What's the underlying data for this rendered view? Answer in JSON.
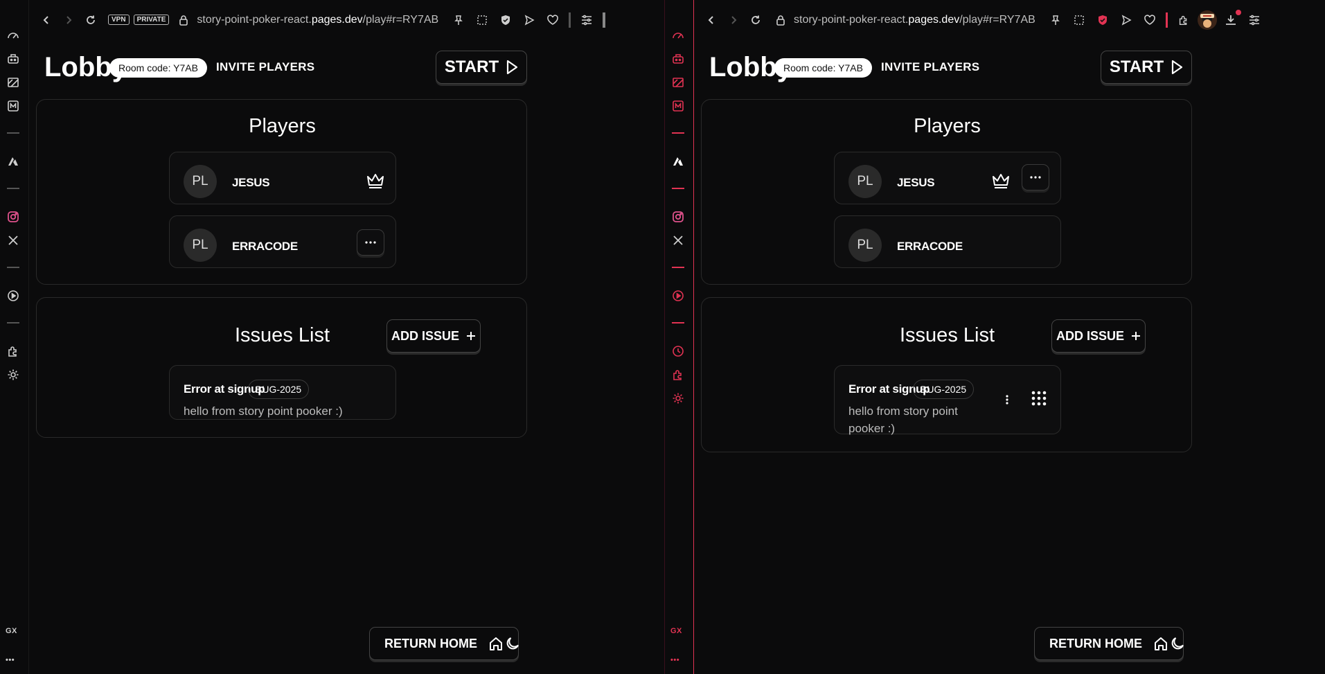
{
  "browser": {
    "tag_vpn": "VPN",
    "tag_private": "PRIVATE",
    "url_prefix": "story-point-poker-react.",
    "url_domain": "pages.dev",
    "url_suffix": "/play#r=RY7AB",
    "sidebar_gx": "GX",
    "sidebar_more": "•••"
  },
  "lobby": {
    "title": "Lobby",
    "room_code": "Room code: Y7AB",
    "invite_label": "INVITE PLAYERS",
    "start_label": "START"
  },
  "players": {
    "heading": "Players",
    "list": [
      {
        "initials": "PL",
        "name": "JESUS",
        "is_host": true
      },
      {
        "initials": "PL",
        "name": "ERRACODE",
        "is_host": false
      }
    ]
  },
  "issues": {
    "heading": "Issues List",
    "add_label": "ADD ISSUE",
    "list": [
      {
        "title": "Error at signup",
        "tag": "BUG-2025",
        "description": "hello from story point pooker :)"
      }
    ]
  },
  "footer": {
    "return_label": "RETURN HOME"
  },
  "colors": {
    "background": "#0b0b0c",
    "accent_opera_red": "#e23353",
    "text": "#ffffff"
  }
}
